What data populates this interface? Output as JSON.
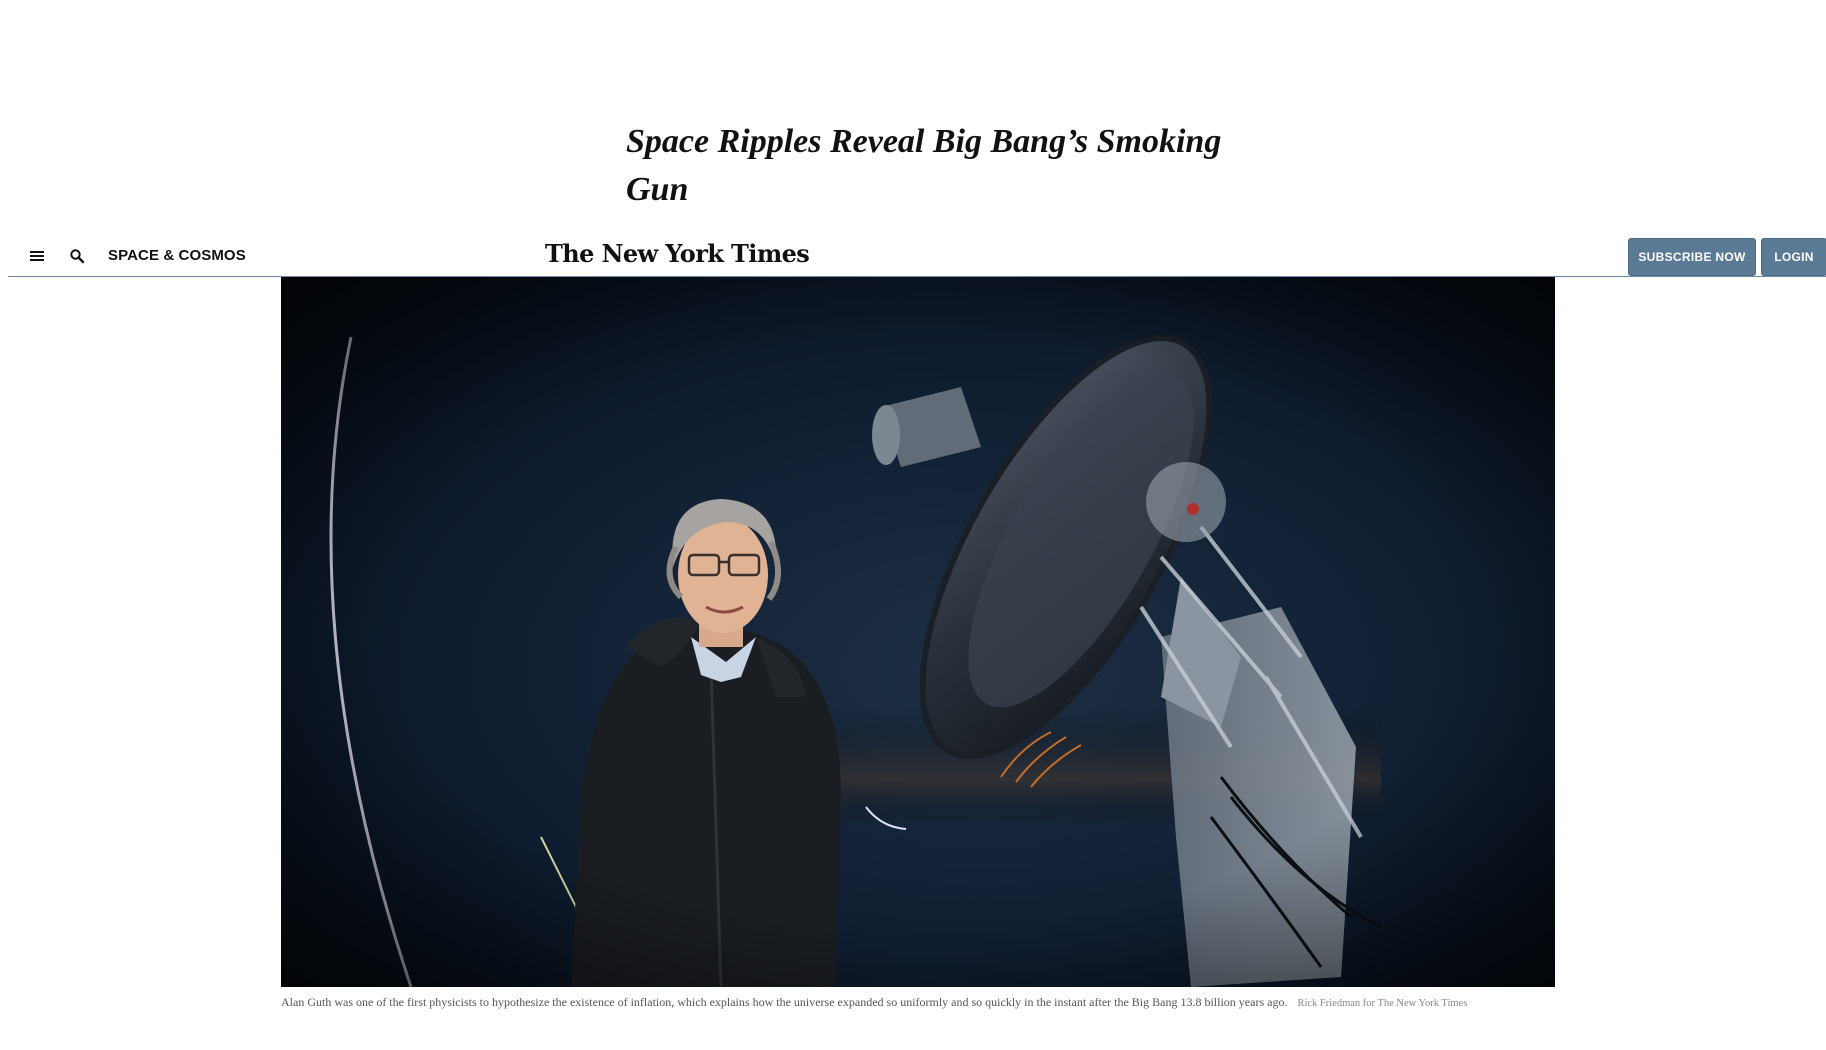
{
  "article": {
    "headline": "Space Ripples Reveal Big Bang’s Smoking Gun"
  },
  "masthead": {
    "menu_icon": "hamburger-menu-icon",
    "search_icon": "search-icon",
    "section": "SPACE & COSMOS",
    "logo": "The New York Times",
    "subscribe_label": "SUBSCRIBE NOW",
    "login_label": "LOGIN"
  },
  "photo": {
    "caption": "Alan Guth was one of the first physicists to hypothesize the existence of inflation, which explains how the universe expanded so uniformly and so quickly in the instant after the Big Bang 13.8 billion years ago.",
    "credit": "Rick Friedman for The New York Times"
  },
  "colors": {
    "button_bg": "#5a7a96",
    "rule": "#6f8aa6",
    "sky": "#0a1524"
  }
}
